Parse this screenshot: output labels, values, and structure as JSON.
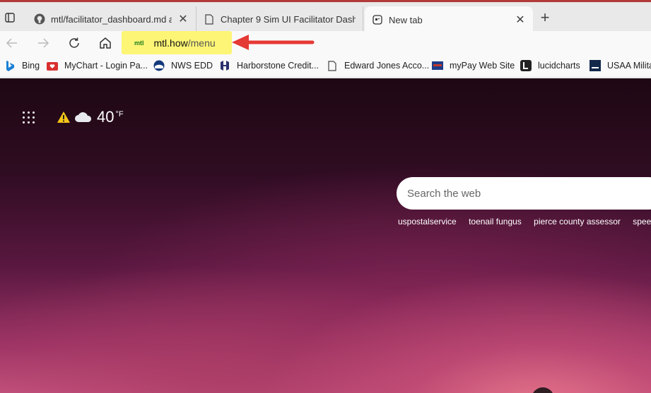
{
  "tabs": [
    {
      "title": "mtl/facilitator_dashboard.md at g",
      "icon": "github-icon"
    },
    {
      "title": "Chapter 9 Sim UI Facilitator Dash",
      "icon": "page-icon"
    },
    {
      "title": "New tab",
      "icon": "newtab-icon",
      "active": true
    }
  ],
  "address": {
    "host": "mtl.how",
    "path": "/menu",
    "favicon": "mtl"
  },
  "favorites": [
    {
      "label": "Bing",
      "icon": "bing-icon"
    },
    {
      "label": "MyChart - Login Pa...",
      "icon": "mychart-icon"
    },
    {
      "label": "NWS EDD",
      "icon": "noaa-icon"
    },
    {
      "label": "Harborstone Credit...",
      "icon": "harborstone-icon"
    },
    {
      "label": "Edward Jones Acco...",
      "icon": "page-icon"
    },
    {
      "label": "myPay Web Site",
      "icon": "mypay-icon"
    },
    {
      "label": "lucidcharts",
      "icon": "lucid-icon"
    },
    {
      "label": "USAA Milita",
      "icon": "usaa-icon"
    }
  ],
  "weather": {
    "temp": "40",
    "unit": "°F"
  },
  "search": {
    "placeholder": "Search the web"
  },
  "trending": [
    "uspostalservice",
    "toenail fungus",
    "pierce county assessor",
    "speedte"
  ],
  "colors": {
    "highlight": "#fdf575",
    "arrow": "#e53935",
    "tabstrip_accent": "#b33a3a"
  }
}
